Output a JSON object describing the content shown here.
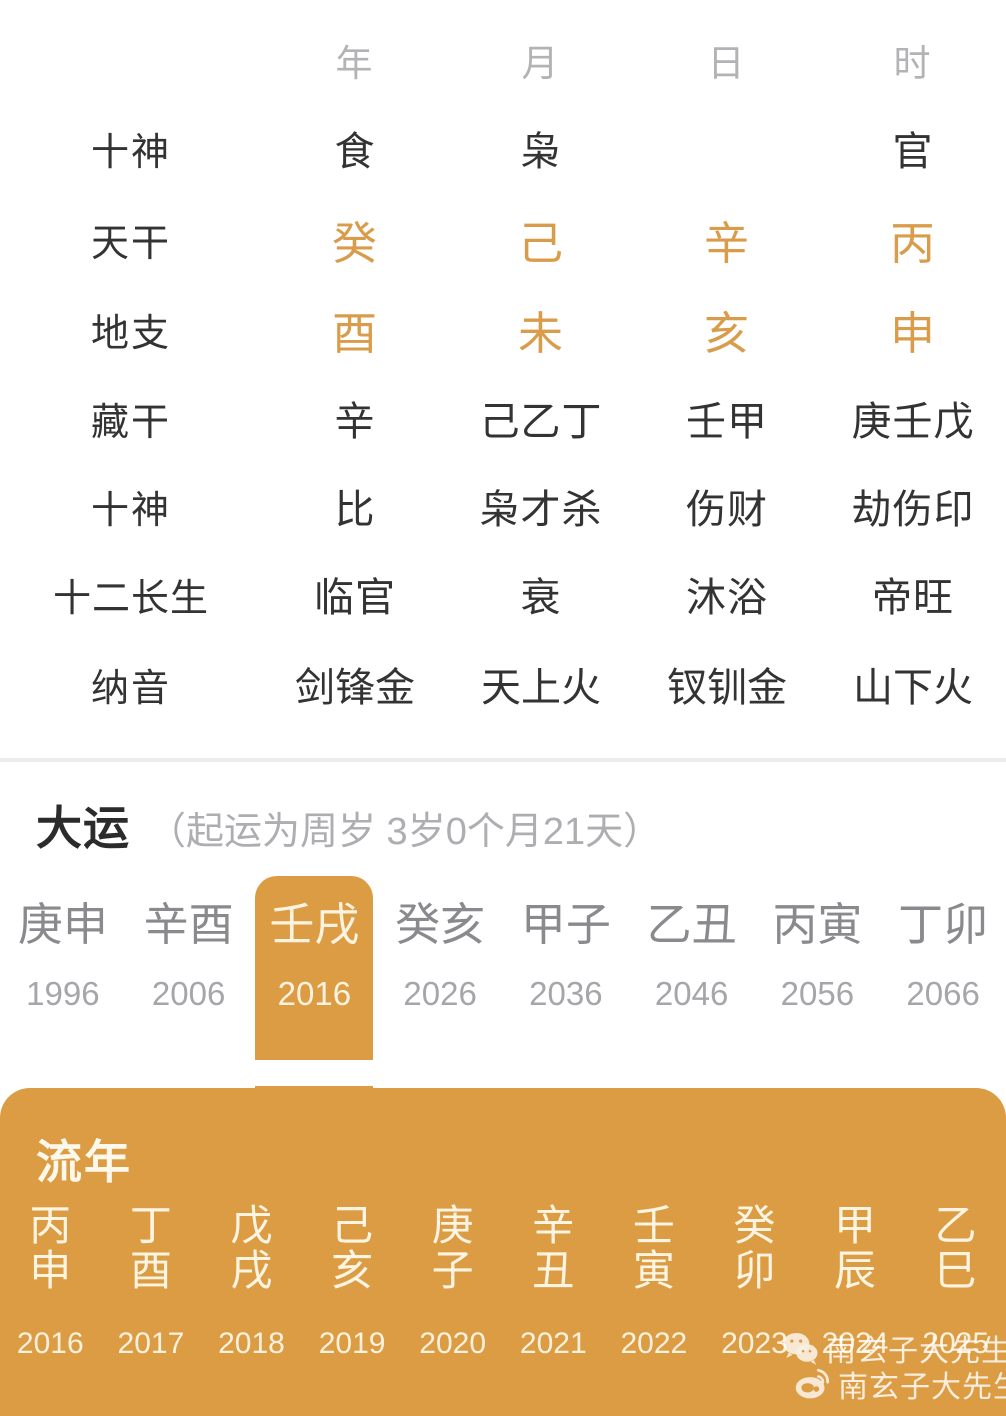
{
  "colors": {
    "accent": "#dc9c44",
    "stem_branch": "#d99c4a",
    "text_primary": "#333333",
    "text_muted": "#b3b3b6",
    "panel_text": "#fdf4e2",
    "background": "#ffffff",
    "divider": "#ececef"
  },
  "pillar_table": {
    "column_headers": [
      "年",
      "月",
      "日",
      "时"
    ],
    "rows": [
      {
        "label": "十神",
        "values": [
          "食",
          "枭",
          "",
          "官"
        ]
      },
      {
        "label": "天干",
        "values": [
          "癸",
          "己",
          "辛",
          "丙"
        ]
      },
      {
        "label": "地支",
        "values": [
          "酉",
          "未",
          "亥",
          "申"
        ]
      },
      {
        "label": "藏干",
        "values": [
          "辛",
          "己乙丁",
          "壬甲",
          "庚壬戊"
        ]
      },
      {
        "label": "十神",
        "values": [
          "比",
          "枭才杀",
          "伤财",
          "劫伤印"
        ]
      },
      {
        "label": "十二长生",
        "values": [
          "临官",
          "衰",
          "沐浴",
          "帝旺"
        ]
      },
      {
        "label": "纳音",
        "values": [
          "剑锋金",
          "天上火",
          "钗钏金",
          "山下火"
        ]
      }
    ]
  },
  "dayun": {
    "title": "大运",
    "subtitle": "（起运为周岁 3岁0个月21天）",
    "active_index": 2,
    "items": [
      {
        "ganzhi": "庚申",
        "year": "1996"
      },
      {
        "ganzhi": "辛酉",
        "year": "2006"
      },
      {
        "ganzhi": "壬戌",
        "year": "2016"
      },
      {
        "ganzhi": "癸亥",
        "year": "2026"
      },
      {
        "ganzhi": "甲子",
        "year": "2036"
      },
      {
        "ganzhi": "乙丑",
        "year": "2046"
      },
      {
        "ganzhi": "丙寅",
        "year": "2056"
      },
      {
        "ganzhi": "丁卯",
        "year": "2066"
      }
    ]
  },
  "liunian": {
    "title": "流年",
    "items": [
      {
        "stem": "丙",
        "branch": "申",
        "year": "2016"
      },
      {
        "stem": "丁",
        "branch": "酉",
        "year": "2017"
      },
      {
        "stem": "戊",
        "branch": "戌",
        "year": "2018"
      },
      {
        "stem": "己",
        "branch": "亥",
        "year": "2019"
      },
      {
        "stem": "庚",
        "branch": "子",
        "year": "2020"
      },
      {
        "stem": "辛",
        "branch": "丑",
        "year": "2021"
      },
      {
        "stem": "壬",
        "branch": "寅",
        "year": "2022"
      },
      {
        "stem": "癸",
        "branch": "卯",
        "year": "2023"
      },
      {
        "stem": "甲",
        "branch": "辰",
        "year": "2024"
      },
      {
        "stem": "乙",
        "branch": "巳",
        "year": "2025"
      }
    ]
  },
  "watermark": {
    "wechat_label": "南玄子大先生",
    "weibo_label": "南玄子大先生"
  }
}
